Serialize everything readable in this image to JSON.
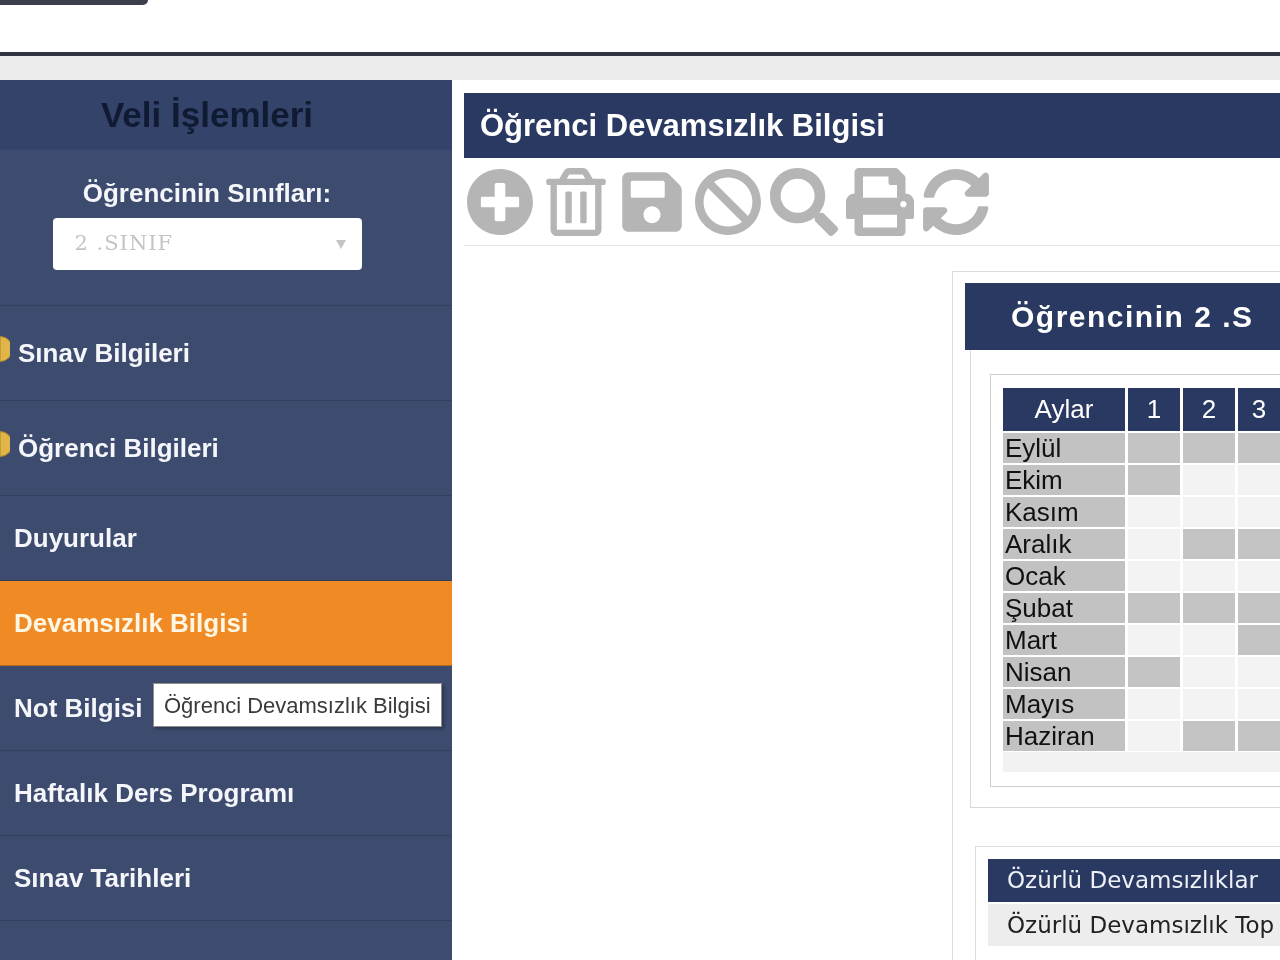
{
  "sidebar": {
    "title": "Veli İşlemleri",
    "class_selector": {
      "label": "Öğrencinin Sınıfları:",
      "value": "2 .SINIF",
      "disabled": true
    },
    "items": [
      {
        "label": "Sınav Bilgileri",
        "bullet": true,
        "selected": false
      },
      {
        "label": "Öğrenci Bilgileri",
        "bullet": true,
        "selected": false
      },
      {
        "label": "Duyurular",
        "bullet": false,
        "selected": false
      },
      {
        "label": "Devamsızlık Bilgisi",
        "bullet": false,
        "selected": true
      },
      {
        "label": "Not Bilgisi",
        "bullet": false,
        "selected": false
      },
      {
        "label": "Haftalık Ders Programı",
        "bullet": false,
        "selected": false
      },
      {
        "label": "Sınav Tarihleri",
        "bullet": false,
        "selected": false
      }
    ]
  },
  "tooltip": {
    "text": "Öğrenci Devamsızlık Bilgisi"
  },
  "panel": {
    "title": "Öğrenci Devamsızlık Bilgisi",
    "toolbar": [
      {
        "kind": "add",
        "disabled": true
      },
      {
        "kind": "delete",
        "disabled": true
      },
      {
        "kind": "save",
        "disabled": true
      },
      {
        "kind": "cancel",
        "disabled": true
      },
      {
        "kind": "search",
        "disabled": true
      },
      {
        "kind": "print",
        "disabled": true
      },
      {
        "kind": "refresh",
        "disabled": true
      }
    ],
    "attendance": {
      "title": "Öğrencinin 2 .S",
      "table": {
        "columns": [
          "Aylar",
          "1",
          "2",
          "3"
        ],
        "rows": [
          {
            "month": "Eylül",
            "days": [
              {
                "shaded": true
              },
              {
                "shaded": true
              },
              {
                "shaded": true
              }
            ]
          },
          {
            "month": "Ekim",
            "days": [
              {
                "shaded": true
              },
              {
                "shaded": false
              },
              {
                "shaded": false
              }
            ]
          },
          {
            "month": "Kasım",
            "days": [
              {
                "shaded": false
              },
              {
                "shaded": false
              },
              {
                "shaded": false
              }
            ]
          },
          {
            "month": "Aralık",
            "days": [
              {
                "shaded": false
              },
              {
                "shaded": true
              },
              {
                "shaded": true
              }
            ]
          },
          {
            "month": "Ocak",
            "days": [
              {
                "shaded": false
              },
              {
                "shaded": false
              },
              {
                "shaded": false
              }
            ]
          },
          {
            "month": "Şubat",
            "days": [
              {
                "shaded": true
              },
              {
                "shaded": true
              },
              {
                "shaded": true
              }
            ]
          },
          {
            "month": "Mart",
            "days": [
              {
                "shaded": false
              },
              {
                "shaded": false
              },
              {
                "shaded": true
              }
            ]
          },
          {
            "month": "Nisan",
            "days": [
              {
                "shaded": true
              },
              {
                "shaded": false
              },
              {
                "shaded": false
              }
            ]
          },
          {
            "month": "Mayıs",
            "days": [
              {
                "shaded": false
              },
              {
                "shaded": false
              },
              {
                "shaded": false
              }
            ]
          },
          {
            "month": "Haziran",
            "days": [
              {
                "shaded": false
              },
              {
                "shaded": true
              },
              {
                "shaded": true
              }
            ]
          }
        ]
      }
    },
    "excused": {
      "title": "Özürlü Devamsızlıklar",
      "rows": [
        "Özürlü Devamsızlık Top"
      ]
    }
  }
}
